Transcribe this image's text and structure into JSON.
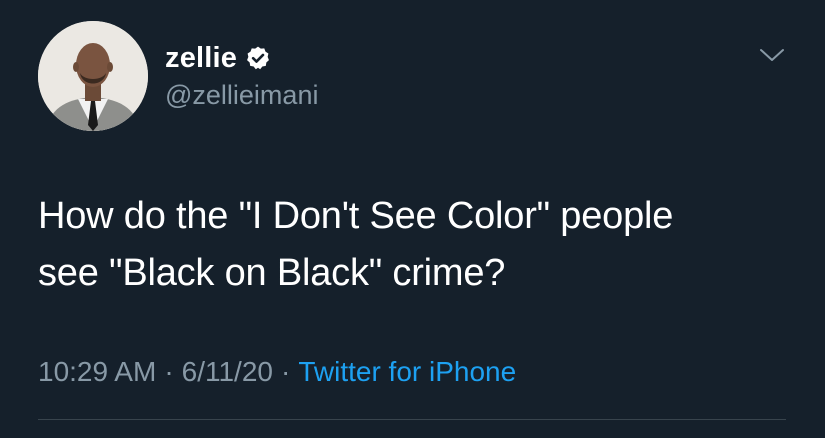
{
  "tweet": {
    "display_name": "zellie",
    "handle": "@zellieimani",
    "verified": true,
    "text": "How do the \"I Don't See Color\" people\nsee \"Black on Black\" crime?",
    "time": "10:29 AM",
    "date": "6/11/20",
    "separator": "·",
    "source": "Twitter for iPhone"
  },
  "icons": {
    "verified": "verified-badge-icon",
    "menu": "chevron-down-icon"
  },
  "colors": {
    "background": "#15202b",
    "text": "#ffffff",
    "secondary": "#8899a6",
    "link": "#1da1f2",
    "divider": "#38444d"
  }
}
